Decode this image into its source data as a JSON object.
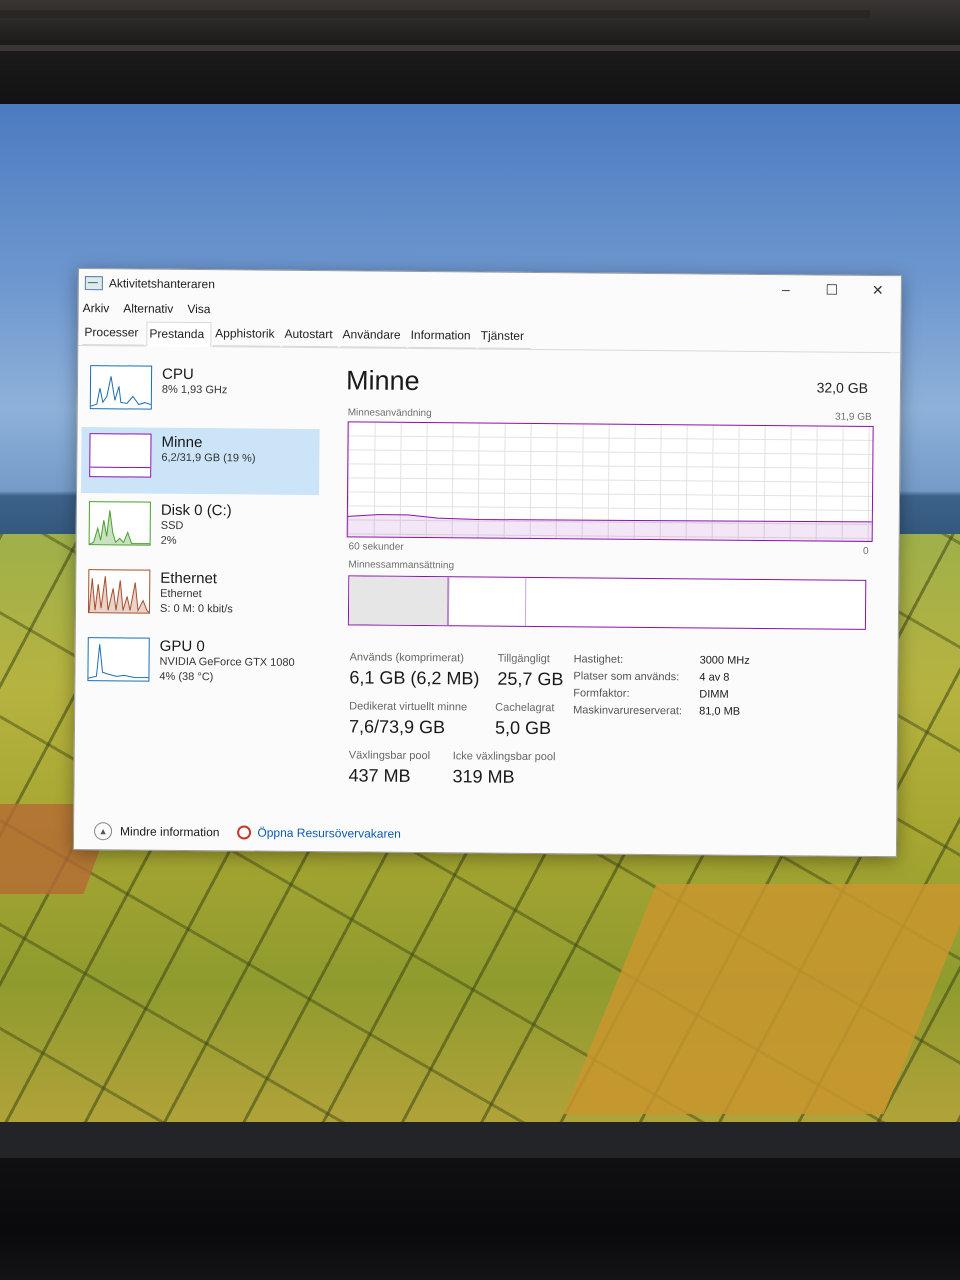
{
  "window": {
    "title": "Aktivitetshanteraren",
    "minimize": "–",
    "maximize": "☐",
    "close": "✕"
  },
  "menu": [
    "Arkiv",
    "Alternativ",
    "Visa"
  ],
  "tabs": [
    "Processer",
    "Prestanda",
    "Apphistorik",
    "Autostart",
    "Användare",
    "Information",
    "Tjänster"
  ],
  "sidebar": [
    {
      "title": "CPU",
      "lines": [
        "8% 1,93 GHz"
      ],
      "color": "#1a6fb4"
    },
    {
      "title": "Minne",
      "lines": [
        "6,2/31,9 GB (19 %)"
      ],
      "color": "#8b12ae"
    },
    {
      "title": "Disk 0 (C:)",
      "lines": [
        "SSD",
        "2%"
      ],
      "color": "#4aa02c"
    },
    {
      "title": "Ethernet",
      "lines": [
        "Ethernet",
        "S: 0 M: 0 kbit/s"
      ],
      "color": "#a74f2c"
    },
    {
      "title": "GPU 0",
      "lines": [
        "NVIDIA GeForce GTX 1080",
        "4% (38 °C)"
      ],
      "color": "#1a6fb4"
    }
  ],
  "panel": {
    "title": "Minne",
    "total": "32,0 GB",
    "graph_label": "Minnesanvändning",
    "graph_max": "31,9 GB",
    "graph_left": "60 sekunder",
    "graph_right": "0",
    "composition_label": "Minnessammansättning",
    "in_use_fraction": 0.19
  },
  "stats": {
    "in_use_label": "Används (komprimerat)",
    "in_use": "6,1 GB (6,2 MB)",
    "available_label": "Tillgängligt",
    "available": "25,7 GB",
    "committed_label": "Dedikerat virtuellt minne",
    "committed": "7,6/73,9 GB",
    "cached_label": "Cachelagrat",
    "cached": "5,0 GB",
    "paged_label": "Växlingsbar pool",
    "paged": "437 MB",
    "nonpaged_label": "Icke växlingsbar pool",
    "nonpaged": "319 MB"
  },
  "details": [
    {
      "k": "Hastighet:",
      "v": "3000 MHz"
    },
    {
      "k": "Platser som används:",
      "v": "4 av 8"
    },
    {
      "k": "Formfaktor:",
      "v": "DIMM"
    },
    {
      "k": "Maskinvarureserverat:",
      "v": "81,0 MB"
    }
  ],
  "footer": {
    "less_info": "Mindre information",
    "open_monitor": "Öppna Resursövervakaren"
  }
}
